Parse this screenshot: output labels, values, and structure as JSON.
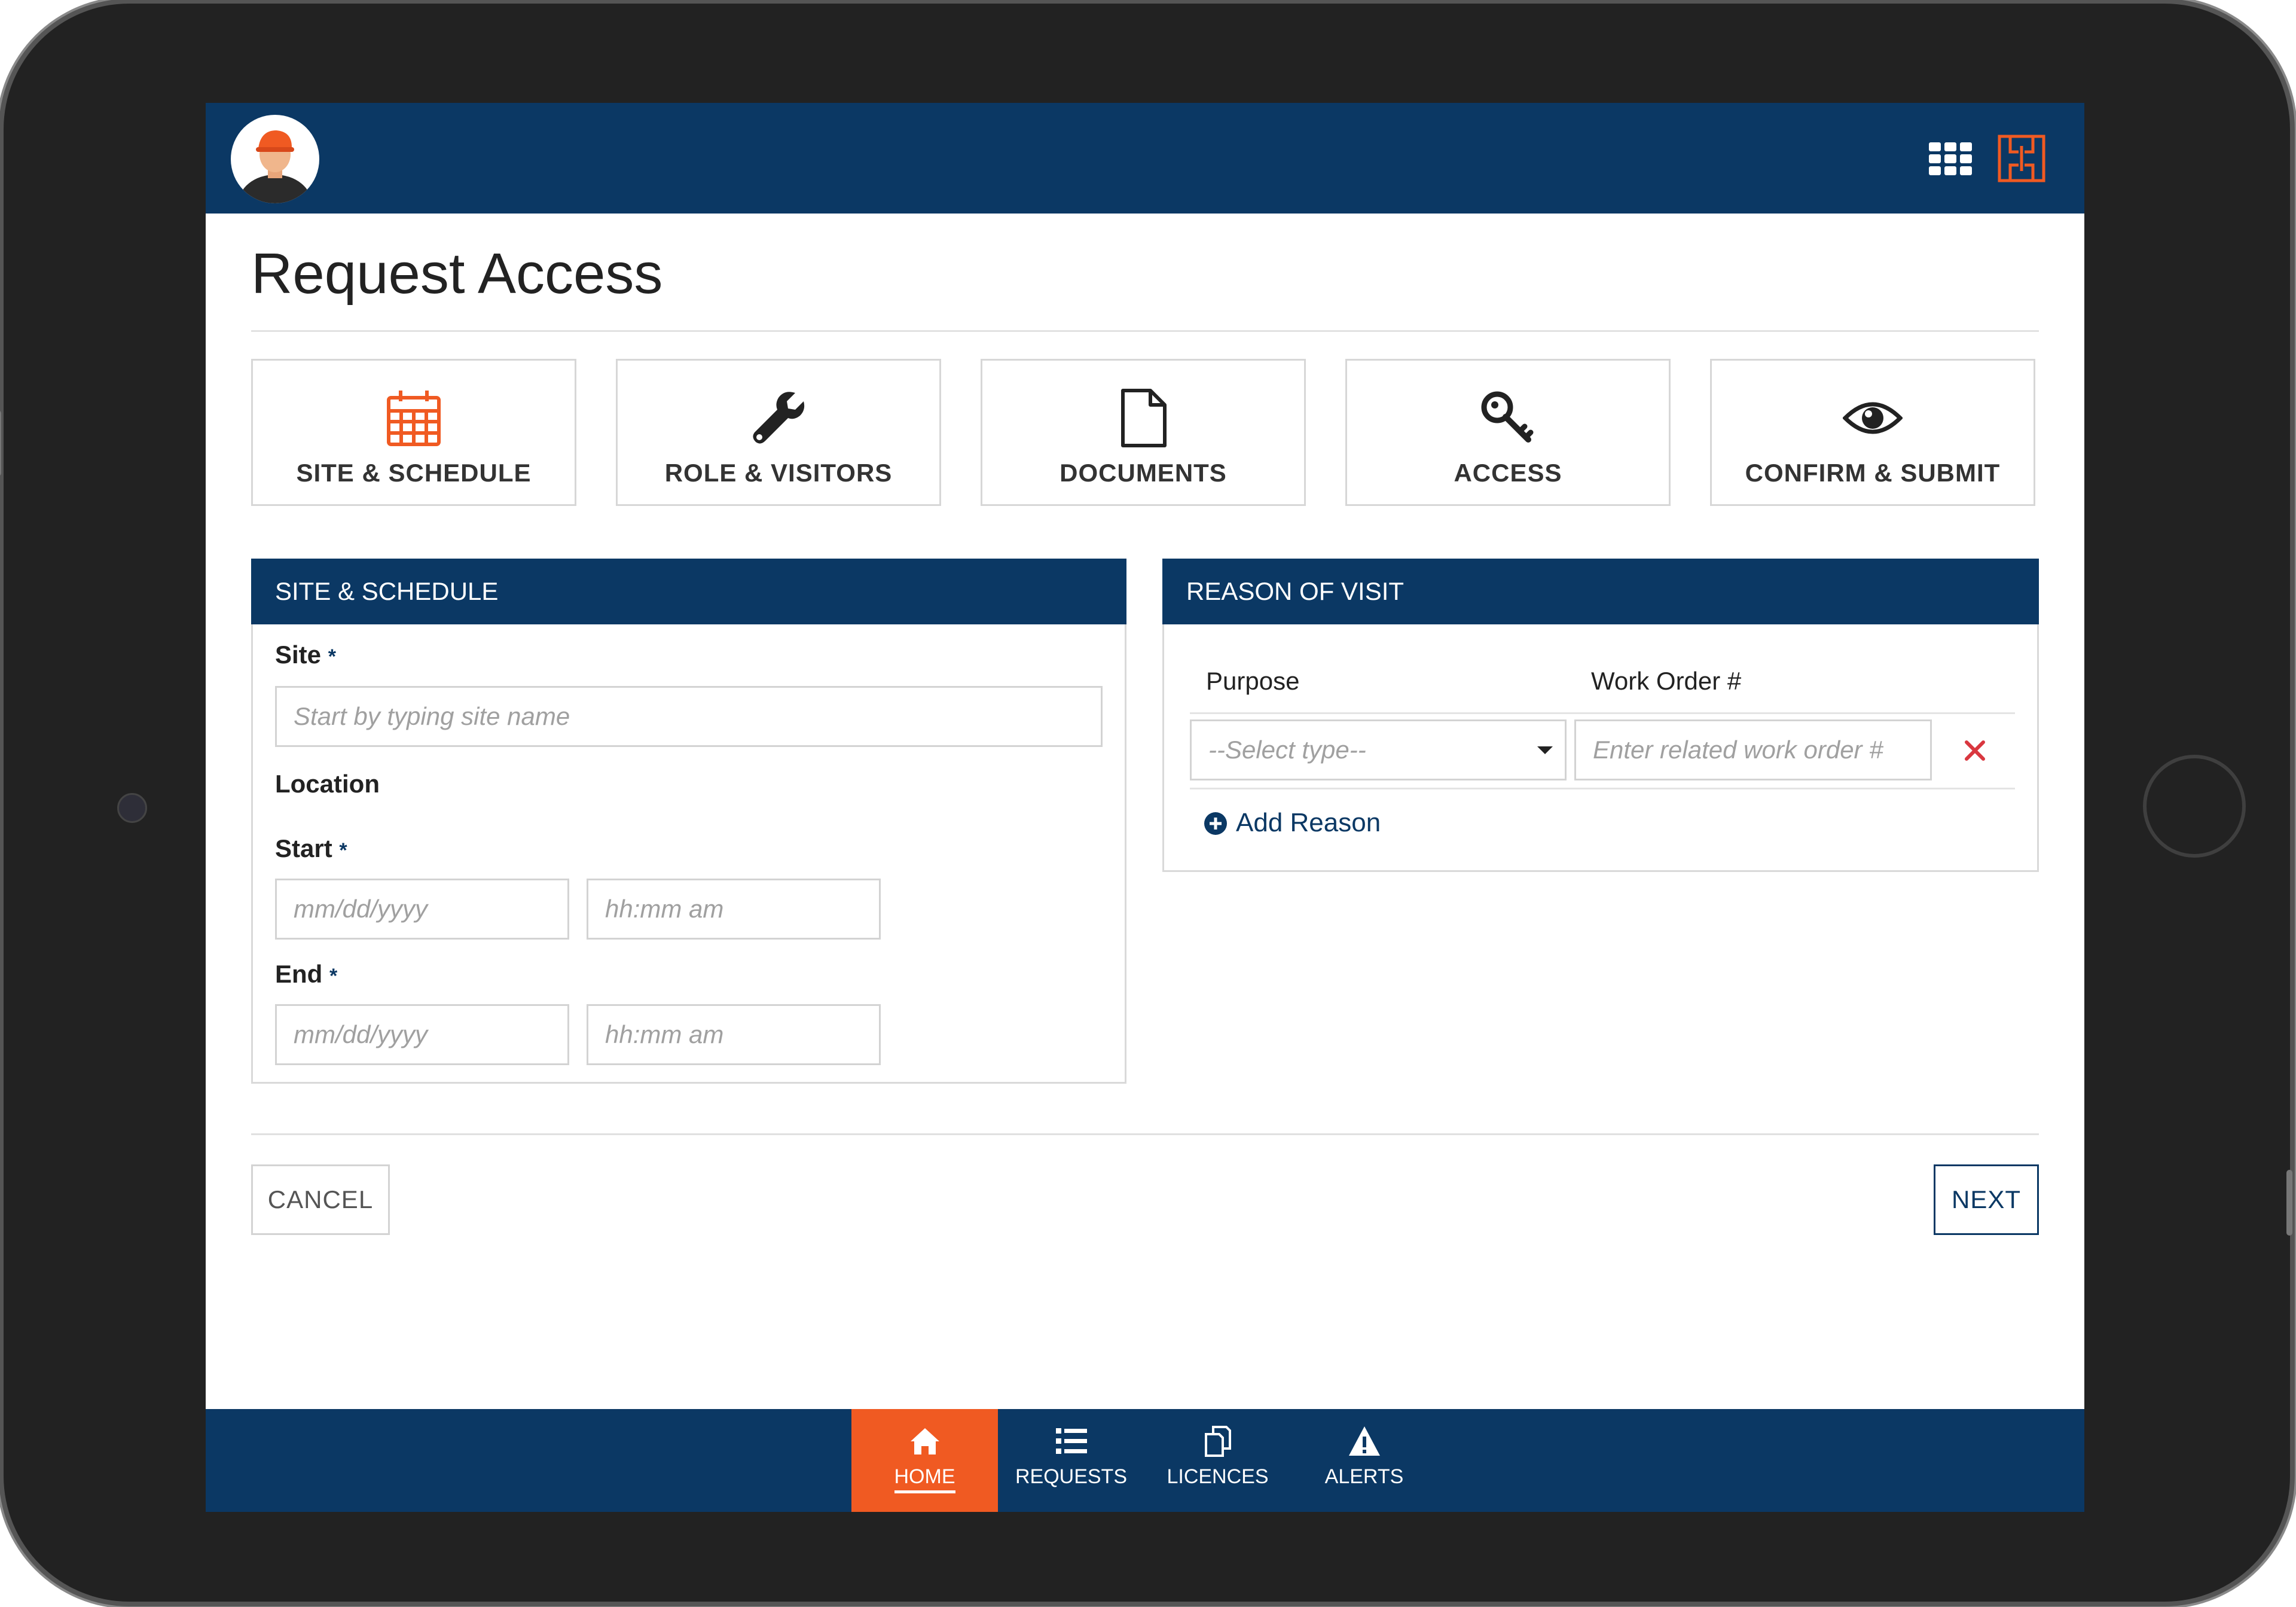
{
  "page": {
    "title": "Request Access"
  },
  "steps": [
    {
      "label": "SITE & SCHEDULE",
      "icon": "calendar-icon",
      "color": "#f05a22"
    },
    {
      "label": "ROLE & VISITORS",
      "icon": "wrench-icon"
    },
    {
      "label": "DOCUMENTS",
      "icon": "document-icon"
    },
    {
      "label": "ACCESS",
      "icon": "key-icon"
    },
    {
      "label": "CONFIRM & SUBMIT",
      "icon": "eye-icon"
    }
  ],
  "site_schedule": {
    "heading": "SITE & SCHEDULE",
    "site_label": "Site",
    "site_placeholder": "Start by typing site name",
    "location_label": "Location",
    "start_label": "Start",
    "start_date_placeholder": "mm/dd/yyyy",
    "start_time_placeholder": "hh:mm am",
    "end_label": "End",
    "end_date_placeholder": "mm/dd/yyyy",
    "end_time_placeholder": "hh:mm am",
    "required_mark": "*"
  },
  "reason": {
    "heading": "REASON OF VISIT",
    "purpose_header": "Purpose",
    "work_order_header": "Work Order #",
    "purpose_select_value": "--Select type--",
    "work_order_placeholder": "Enter related work order #",
    "add_reason_label": "Add Reason"
  },
  "actions": {
    "cancel_label": "CANCEL",
    "next_label": "NEXT"
  },
  "bottom_nav": [
    {
      "label": "HOME",
      "icon": "home-icon",
      "active": true
    },
    {
      "label": "REQUESTS",
      "icon": "list-icon",
      "active": false
    },
    {
      "label": "LICENCES",
      "icon": "licences-icon",
      "active": false
    },
    {
      "label": "ALERTS",
      "icon": "alert-icon",
      "active": false
    }
  ],
  "colors": {
    "primary": "#0b3864",
    "accent": "#f05a22",
    "danger": "#d9373f"
  }
}
